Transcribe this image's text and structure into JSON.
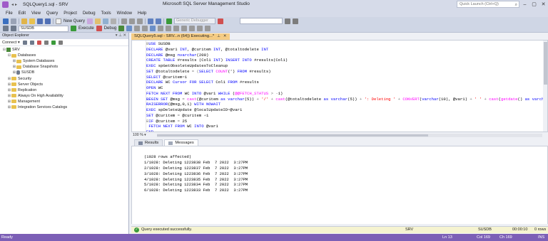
{
  "titlebar": {
    "doc_title": "SQLQuery1.sql - SRV",
    "app_title": "Microsoft SQL Server Management Studio",
    "quick_launch_placeholder": "Quick Launch (Ctrl+Q)"
  },
  "menu": [
    "File",
    "Edit",
    "View",
    "Query",
    "Project",
    "Debug",
    "Tools",
    "Window",
    "Help"
  ],
  "toolbar": {
    "new_query": "New Query",
    "database": "SUSDB",
    "execute": "Execute",
    "debug": "Debug",
    "solution_config": "Generic Debugger",
    "search_combo": ""
  },
  "object_explorer": {
    "title": "Object Explorer",
    "connect": "Connect",
    "tree": [
      {
        "label": "SRV",
        "expander": "⊟",
        "icon": "server",
        "level": 0
      },
      {
        "label": "Databases",
        "expander": "⊟",
        "icon": "folder",
        "level": 1
      },
      {
        "label": "System Databases",
        "expander": "⊞",
        "icon": "folder",
        "level": 2
      },
      {
        "label": "Database Snapshots",
        "expander": "⊞",
        "icon": "folder",
        "level": 2
      },
      {
        "label": "SUSDB",
        "expander": "⊞",
        "icon": "database",
        "level": 2
      },
      {
        "label": "Security",
        "expander": "⊞",
        "icon": "folder",
        "level": 1
      },
      {
        "label": "Server Objects",
        "expander": "⊞",
        "icon": "folder",
        "level": 1
      },
      {
        "label": "Replication",
        "expander": "⊞",
        "icon": "folder",
        "level": 1
      },
      {
        "label": "Always On High Availability",
        "expander": "⊞",
        "icon": "folder",
        "level": 1
      },
      {
        "label": "Management",
        "expander": "⊞",
        "icon": "folder",
        "level": 1
      },
      {
        "label": "Integration Services Catalogs",
        "expander": "⊞",
        "icon": "folder",
        "level": 1
      }
    ]
  },
  "editor": {
    "tab_title": "SQLQuery5.sql - SRV...n (64)) Executing...*",
    "zoom": "100 %"
  },
  "results": {
    "tabs": [
      "Results",
      "Messages"
    ],
    "messages": [
      "(1028 rows affected)",
      "1/1028: Deleting 1223838 Feb  7 2022  3:27PM",
      "2/1028: Deleting 1223837 Feb  7 2022  3:27PM",
      "3/1028: Deleting 1223836 Feb  7 2022  3:27PM",
      "4/1028: Deleting 1223835 Feb  7 2022  3:27PM",
      "5/1028: Deleting 1223834 Feb  7 2022  3:27PM",
      "6/1028: Deleting 1223833 Feb  7 2022  3:27PM"
    ]
  },
  "query_status": {
    "message": "Query executed successfully.",
    "server": "SRV",
    "user": "SUSDB",
    "time": "00:00:10",
    "rows": "0 rows"
  },
  "statusbar": {
    "ready": "Ready",
    "ln": "Ln 13",
    "col": "Col 169",
    "ch": "Ch 169",
    "ins": "INS"
  }
}
